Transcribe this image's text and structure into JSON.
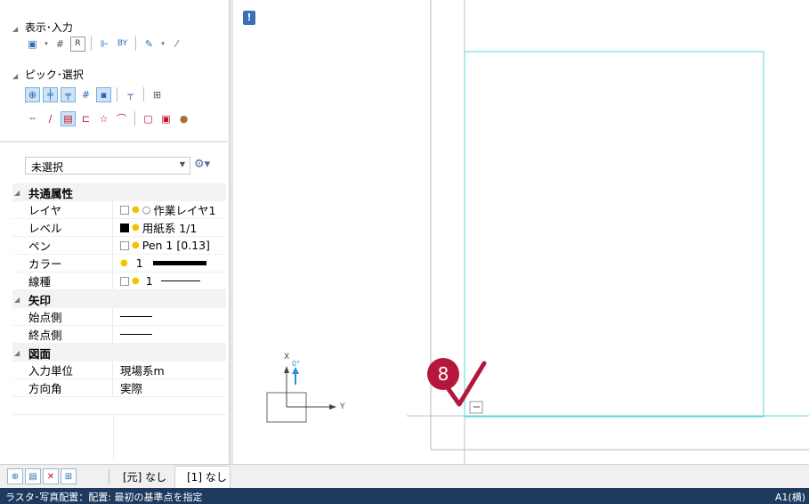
{
  "panel": {
    "display_section": "表示･入力",
    "pick_section": "ピック･選択",
    "selection": "未選択"
  },
  "properties": {
    "common_header": "共通属性",
    "layer": {
      "label": "レイヤ",
      "value": "作業レイヤ1"
    },
    "level": {
      "label": "レベル",
      "value": "用紙系 1/1"
    },
    "pen": {
      "label": "ペン",
      "value": "Pen 1 [0.13]"
    },
    "color": {
      "label": "カラー",
      "value": "1"
    },
    "linetype": {
      "label": "線種",
      "value": "1"
    },
    "arrow_header": "矢印",
    "start": {
      "label": "始点側"
    },
    "end": {
      "label": "終点側"
    },
    "drawing_header": "図面",
    "input_unit": {
      "label": "入力単位",
      "value": "現場系m"
    },
    "direction": {
      "label": "方向角",
      "value": "実際"
    }
  },
  "canvas": {
    "info_marker": "!",
    "step_badge": "8",
    "axis_x": "X",
    "axis_y": "Y",
    "angle": "0°",
    "colors": {
      "cyan": "#58d8d8",
      "gray": "#b8b8b8",
      "check": "#b5163b"
    }
  },
  "bottom": {
    "tab1": "[元] なし",
    "tab2": "[1] なし"
  },
  "status": {
    "text": "ラスタ･写真配置：配置: 最初の基準点を指定",
    "right": "A1(横)"
  }
}
